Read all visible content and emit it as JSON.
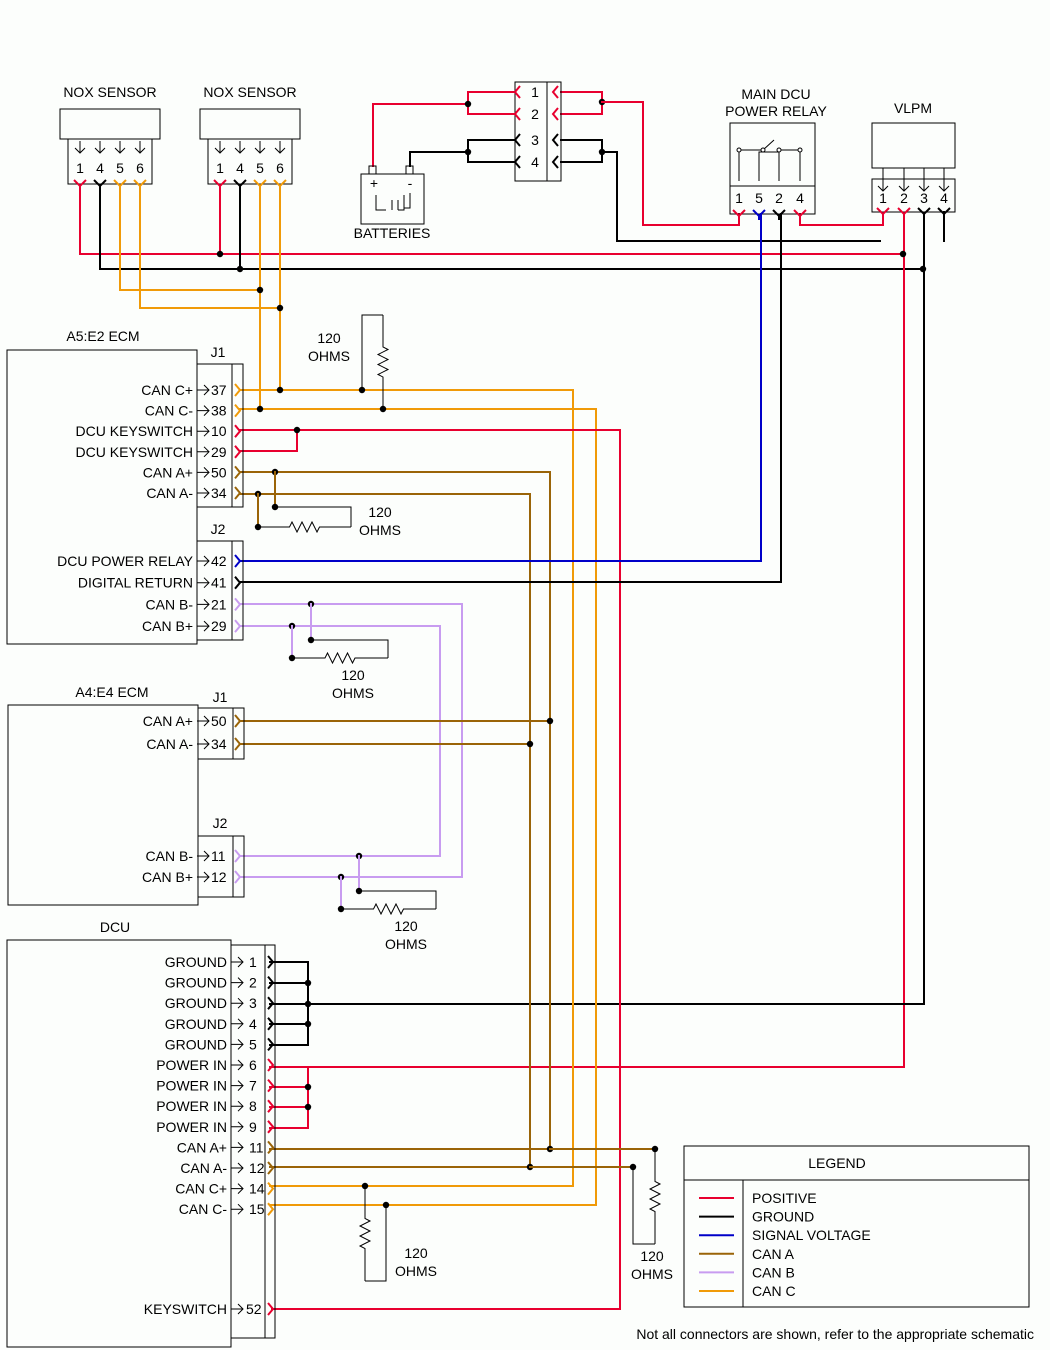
{
  "colors": {
    "positive": "#e8002f",
    "ground": "#000000",
    "signal": "#0000c8",
    "can_a": "#9a6408",
    "can_b": "#c89cf0",
    "can_c": "#f09a08"
  },
  "components": {
    "nox1": {
      "title": "NOX SENSOR",
      "pins": [
        "1",
        "4",
        "5",
        "6"
      ]
    },
    "nox2": {
      "title": "NOX SENSOR",
      "pins": [
        "1",
        "4",
        "5",
        "6"
      ]
    },
    "batteries": {
      "title": "BATTERIES",
      "plus": "+",
      "minus": "-"
    },
    "junction": {
      "pins": [
        "1",
        "2",
        "3",
        "4"
      ]
    },
    "relay": {
      "title_line1": "MAIN DCU",
      "title_line2": "POWER RELAY",
      "pins": [
        "1",
        "5",
        "2",
        "4"
      ]
    },
    "vlpm": {
      "title": "VLPM",
      "pins": [
        "1",
        "2",
        "3",
        "4"
      ]
    },
    "ecm_a5": {
      "title": "A5:E2 ECM",
      "j1": "J1",
      "j2": "J2",
      "j1_pins": [
        {
          "label": "CAN C+",
          "pin": "37"
        },
        {
          "label": "CAN C-",
          "pin": "38"
        },
        {
          "label": "DCU KEYSWITCH",
          "pin": "10"
        },
        {
          "label": "DCU KEYSWITCH",
          "pin": "29"
        },
        {
          "label": "CAN A+",
          "pin": "50"
        },
        {
          "label": "CAN A-",
          "pin": "34"
        }
      ],
      "j2_pins": [
        {
          "label": "DCU POWER RELAY",
          "pin": "42"
        },
        {
          "label": "DIGITAL RETURN",
          "pin": "41"
        },
        {
          "label": "CAN B-",
          "pin": "21"
        },
        {
          "label": "CAN B+",
          "pin": "29"
        }
      ]
    },
    "ecm_a4": {
      "title": "A4:E4 ECM",
      "j1": "J1",
      "j2": "J2",
      "j1_pins": [
        {
          "label": "CAN A+",
          "pin": "50"
        },
        {
          "label": "CAN A-",
          "pin": "34"
        }
      ],
      "j2_pins": [
        {
          "label": "CAN B-",
          "pin": "11"
        },
        {
          "label": "CAN B+",
          "pin": "12"
        }
      ]
    },
    "dcu": {
      "title": "DCU",
      "pins": [
        {
          "label": "GROUND",
          "pin": "1"
        },
        {
          "label": "GROUND",
          "pin": "2"
        },
        {
          "label": "GROUND",
          "pin": "3"
        },
        {
          "label": "GROUND",
          "pin": "4"
        },
        {
          "label": "GROUND",
          "pin": "5"
        },
        {
          "label": "POWER IN",
          "pin": "6"
        },
        {
          "label": "POWER IN",
          "pin": "7"
        },
        {
          "label": "POWER IN",
          "pin": "8"
        },
        {
          "label": "POWER IN",
          "pin": "9"
        },
        {
          "label": "CAN A+",
          "pin": "11"
        },
        {
          "label": "CAN A-",
          "pin": "12"
        },
        {
          "label": "CAN C+",
          "pin": "14"
        },
        {
          "label": "CAN C-",
          "pin": "15"
        }
      ],
      "keyswitch": {
        "label": "KEYSWITCH",
        "pin": "52"
      }
    }
  },
  "resistors": {
    "value_line1": "120",
    "value_line2": "OHMS"
  },
  "legend": {
    "title": "LEGEND",
    "items": [
      {
        "label": "POSITIVE",
        "color_key": "positive"
      },
      {
        "label": "GROUND",
        "color_key": "ground"
      },
      {
        "label": "SIGNAL VOLTAGE",
        "color_key": "signal"
      },
      {
        "label": "CAN A",
        "color_key": "can_a"
      },
      {
        "label": "CAN B",
        "color_key": "can_b"
      },
      {
        "label": "CAN C",
        "color_key": "can_c"
      }
    ]
  },
  "footnote": "Not all connectors are shown, refer to the appropriate schematic"
}
